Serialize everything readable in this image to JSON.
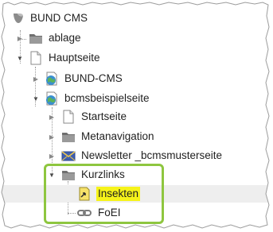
{
  "tree": {
    "root": {
      "label": "BUND CMS",
      "icon": "typo3-logo-icon"
    },
    "nodes": [
      {
        "label": "ablage",
        "icon": "folder-icon",
        "state": "collapsed"
      },
      {
        "label": "Hauptseite",
        "icon": "page-icon",
        "state": "expanded"
      },
      {
        "label": "BUND-CMS",
        "icon": "globe-page-icon",
        "state": "collapsed"
      },
      {
        "label": "bcmsbeispielseite",
        "icon": "globe-page-icon",
        "state": "expanded"
      },
      {
        "label": "Startseite",
        "icon": "page-icon",
        "state": "collapsed"
      },
      {
        "label": "Metanavigation",
        "icon": "folder-icon",
        "state": "collapsed"
      },
      {
        "label": "Newsletter _bcmsmusterseite",
        "icon": "newsletter-icon",
        "state": "collapsed"
      },
      {
        "label": "Kurzlinks",
        "icon": "folder-icon",
        "state": "expanded"
      },
      {
        "label": "Insekten",
        "icon": "shortcut-page-icon",
        "state": "leaf",
        "highlighted": true
      },
      {
        "label": "FoEI",
        "icon": "link-icon",
        "state": "leaf"
      }
    ]
  },
  "colors": {
    "highlight": "#f6f31a",
    "annotation_box": "#8ec63f",
    "selected_row": "#eeeeee"
  }
}
